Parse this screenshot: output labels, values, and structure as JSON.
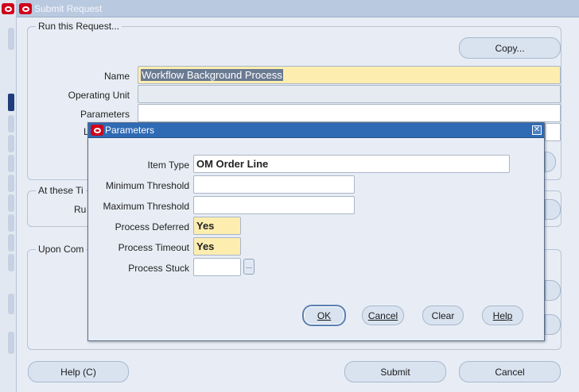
{
  "main_window": {
    "title": "Submit Request",
    "run_group_label": "Run this Request...",
    "copy_label": "Copy...",
    "name_label": "Name",
    "name_value": "Workflow Background Process",
    "operating_unit_label": "Operating Unit",
    "operating_unit_value": "",
    "parameters_label": "Parameters",
    "parameters_value": "",
    "times_group_label": "At these Ti",
    "times_row_label": "Ru",
    "completion_group_label": "Upon Com",
    "hidden_label_fragment": "L",
    "help_label": "Help (C)",
    "submit_label": "Submit",
    "cancel_label": "Cancel"
  },
  "dialog": {
    "title": "Parameters",
    "fields": [
      {
        "label": "Item Type",
        "value": "OM Order Line"
      },
      {
        "label": "Minimum Threshold",
        "value": ""
      },
      {
        "label": "Maximum Threshold",
        "value": ""
      },
      {
        "label": "Process Deferred",
        "value": "Yes"
      },
      {
        "label": "Process Timeout",
        "value": "Yes"
      },
      {
        "label": "Process Stuck",
        "value": ""
      }
    ],
    "lov_glyph": "...",
    "buttons": {
      "ok": "OK",
      "cancel": "Cancel",
      "clear": "Clear",
      "help": "Help"
    }
  },
  "colors": {
    "title_active": "#2f6ab4",
    "title_inactive": "#b9c9e0",
    "required_field": "#fdeeb0",
    "brand_logo": "#d0021b"
  }
}
